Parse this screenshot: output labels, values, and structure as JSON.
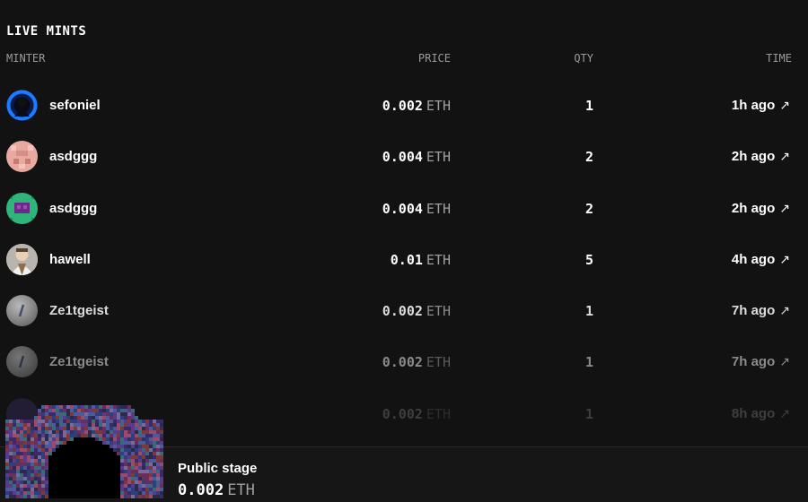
{
  "title": "LIVE MINTS",
  "columns": {
    "minter": "MINTER",
    "price": "PRICE",
    "qty": "QTY",
    "time": "TIME"
  },
  "rows": [
    {
      "minter": "sefoniel",
      "price": "0.002",
      "currency": "ETH",
      "qty": "1",
      "time": "1h ago",
      "avatar": "blue-glow-avatar"
    },
    {
      "minter": "asdggg",
      "price": "0.004",
      "currency": "ETH",
      "qty": "2",
      "time": "2h ago",
      "avatar": "pink-pixel-avatar"
    },
    {
      "minter": "asdggg",
      "price": "0.004",
      "currency": "ETH",
      "qty": "2",
      "time": "2h ago",
      "avatar": "green-pixel-avatar"
    },
    {
      "minter": "hawell",
      "price": "0.01",
      "currency": "ETH",
      "qty": "5",
      "time": "4h ago",
      "avatar": "photo-avatar"
    },
    {
      "minter": "Ze1tgeist",
      "price": "0.002",
      "currency": "ETH",
      "qty": "1",
      "time": "7h ago",
      "avatar": "gray-slash-avatar"
    },
    {
      "minter": "Ze1tgeist",
      "price": "0.002",
      "currency": "ETH",
      "qty": "1",
      "time": "7h ago",
      "avatar": "gray-slash-avatar"
    },
    {
      "minter": "",
      "price": "0.002",
      "currency": "ETH",
      "qty": "1",
      "time": "8h ago",
      "avatar": "purple-avatar"
    }
  ],
  "footer": {
    "stage_label": "Public stage",
    "price": "0.002",
    "currency": "ETH"
  },
  "icons": {
    "external_link": "arrow-up-right-icon"
  },
  "colors": {
    "background": "#121212",
    "muted_text": "#9a9a9a"
  }
}
